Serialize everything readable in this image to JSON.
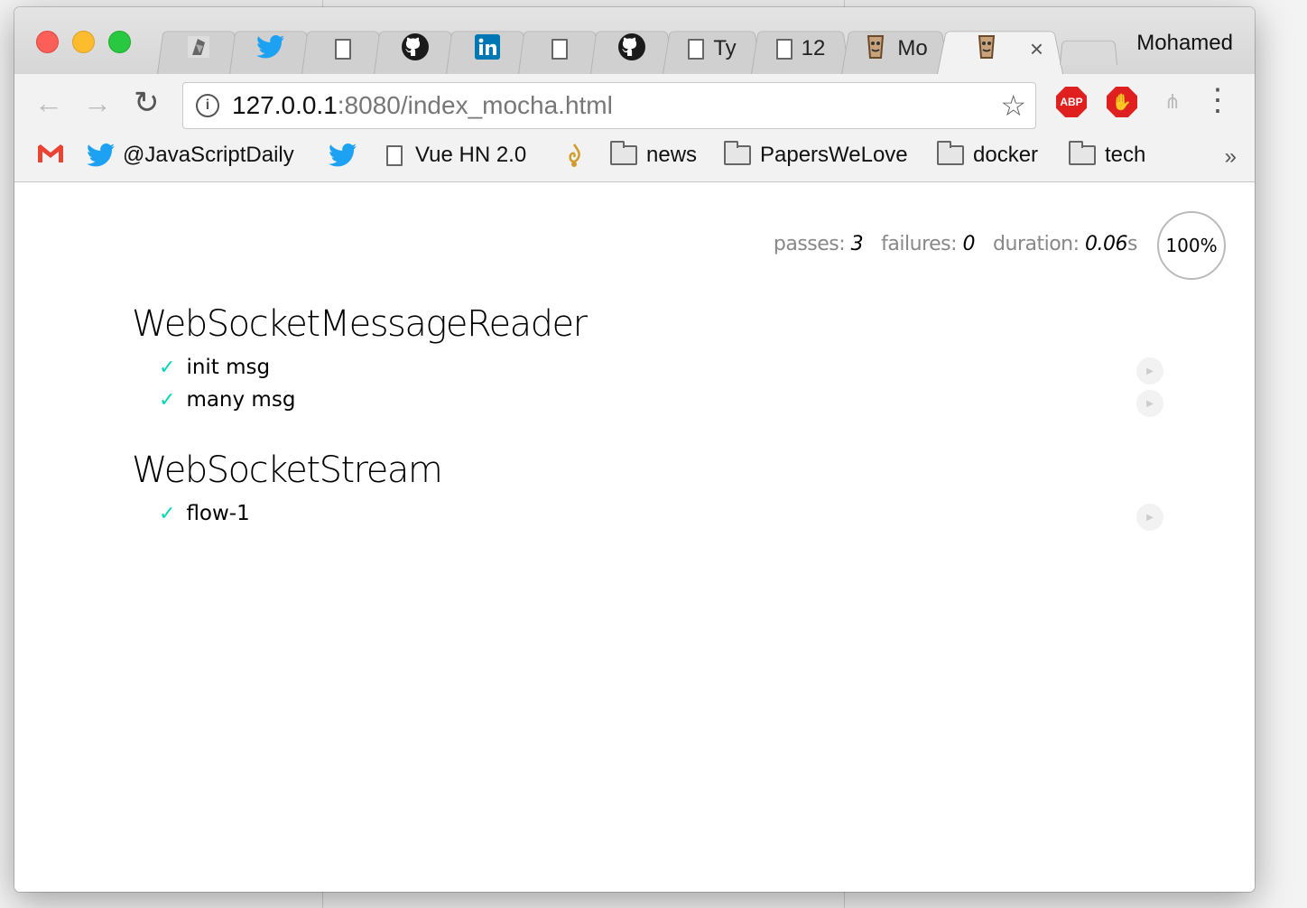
{
  "window": {
    "profile_name": "Mohamed",
    "tabs": [
      {
        "icon": "bird-favicon-icon",
        "title": ""
      },
      {
        "icon": "twitter-icon",
        "title": ""
      },
      {
        "icon": "page-icon",
        "title": ""
      },
      {
        "icon": "github-icon",
        "title": ""
      },
      {
        "icon": "linkedin-icon",
        "title": ""
      },
      {
        "icon": "page-icon",
        "title": ""
      },
      {
        "icon": "github-icon",
        "title": ""
      },
      {
        "icon": "page-icon",
        "title": "Ty"
      },
      {
        "icon": "page-icon",
        "title": "12"
      },
      {
        "icon": "mocha-icon",
        "title": "Mo"
      },
      {
        "icon": "mocha-icon",
        "title": "",
        "active": true
      }
    ],
    "close_glyph": "×"
  },
  "toolbar": {
    "back": "←",
    "forward": "→",
    "reload": "↻",
    "url_host": "127.0.0.1",
    "url_path": ":8080/index_mocha.html",
    "info_glyph": "i",
    "star": "☆",
    "abp_label": "ABP",
    "ublock_glyph": "✋",
    "tree_glyph": "⋔",
    "menu": "⋮"
  },
  "bookmarks": {
    "items": [
      {
        "icon": "gmail-icon",
        "label": ""
      },
      {
        "icon": "twitter-icon",
        "label": "@JavaScriptDaily"
      },
      {
        "icon": "twitter-icon",
        "label": ""
      },
      {
        "icon": "page-icon",
        "label": "Vue HN 2.0"
      },
      {
        "icon": "aljazeera-icon",
        "label": ""
      },
      {
        "icon": "folder-icon",
        "label": "news"
      },
      {
        "icon": "folder-icon",
        "label": "PapersWeLove"
      },
      {
        "icon": "folder-icon",
        "label": "docker"
      },
      {
        "icon": "folder-icon",
        "label": "tech"
      }
    ],
    "more": "»"
  },
  "mocha": {
    "stats": {
      "passes_label": "passes:",
      "passes": "3",
      "failures_label": "failures:",
      "failures": "0",
      "duration_label": "duration:",
      "duration": "0.06",
      "duration_unit": "s"
    },
    "progress": "100%",
    "progress_value": 1.0,
    "suites": [
      {
        "title": "WebSocketMessageReader",
        "tests": [
          "init msg",
          "many msg"
        ]
      },
      {
        "title": "WebSocketStream",
        "tests": [
          "flow-1"
        ]
      }
    ],
    "check_glyph": "✓",
    "replay_glyph": "▶"
  },
  "colors": {
    "pass_check": "#00d6b2",
    "twitter": "#1da1f2",
    "linkedin": "#0077b5",
    "gmail": "#ea4335"
  }
}
